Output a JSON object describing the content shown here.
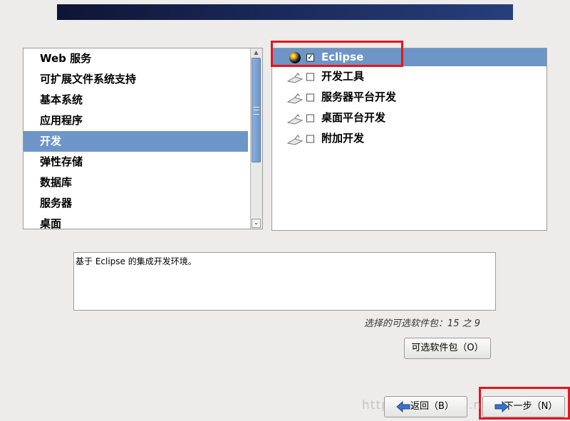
{
  "group_list": {
    "items": [
      {
        "label": "Web 服务"
      },
      {
        "label": "可扩展文件系统支持"
      },
      {
        "label": "基本系统"
      },
      {
        "label": "应用程序"
      },
      {
        "label": "开发",
        "selected": true
      },
      {
        "label": "弹性存储"
      },
      {
        "label": "数据库"
      },
      {
        "label": "服务器"
      },
      {
        "label": "桌面"
      }
    ]
  },
  "package_list": {
    "items": [
      {
        "label": "Eclipse",
        "checked": true,
        "selected": true,
        "icon": "globe-icon"
      },
      {
        "label": "开发工具",
        "checked": false,
        "icon": "package-icon"
      },
      {
        "label": "服务器平台开发",
        "checked": false,
        "icon": "package-icon"
      },
      {
        "label": "桌面平台开发",
        "checked": false,
        "icon": "package-icon"
      },
      {
        "label": "附加开发",
        "checked": false,
        "icon": "package-icon"
      }
    ]
  },
  "description": "基于 Eclipse 的集成开发环境。",
  "selected_count": "选择的可选软件包：15 之 9",
  "buttons": {
    "optional_packages": "可选软件包（O）",
    "back": "返回（B）",
    "next": "下一步（N）"
  },
  "watermark": "http://blog.csdn.net/...",
  "colors": {
    "selection": "#6d95c8",
    "highlight": "#e8141b",
    "banner": "#1c2c5e"
  }
}
